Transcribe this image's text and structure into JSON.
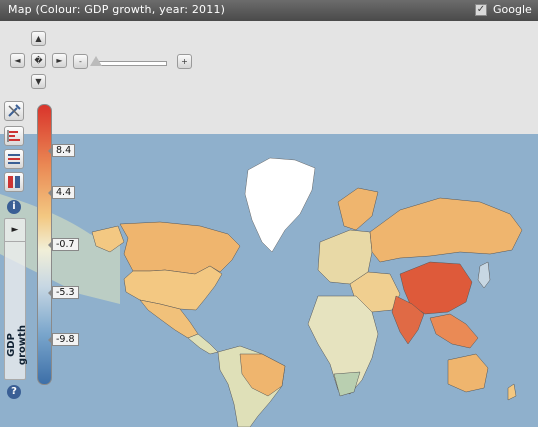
{
  "header": {
    "title": "Map (Colour: GDP growth, year: 2011)",
    "google_label": "Google",
    "google_checked": true
  },
  "nav": {
    "up": "▲",
    "down": "▼",
    "left": "◄",
    "right": "►",
    "center": "�",
    "zoom_out": "-",
    "zoom_in": "+"
  },
  "legend": {
    "title": "GDP growth",
    "ticks": [
      "8.4",
      "4.4",
      "-0.7",
      "-5.3",
      "-9.8"
    ],
    "colors": [
      "#d9342b",
      "#ea8a55",
      "#f3c882",
      "#f1efd8",
      "#7aa6cc",
      "#3d6fa8"
    ]
  },
  "toolbar": {
    "info_label": "i",
    "help_label": "?",
    "play_label": "►"
  },
  "map": {
    "ocean_color": "#8fb0cc",
    "greenland_color": "#ffffff",
    "china_color": "#de5a3a"
  }
}
